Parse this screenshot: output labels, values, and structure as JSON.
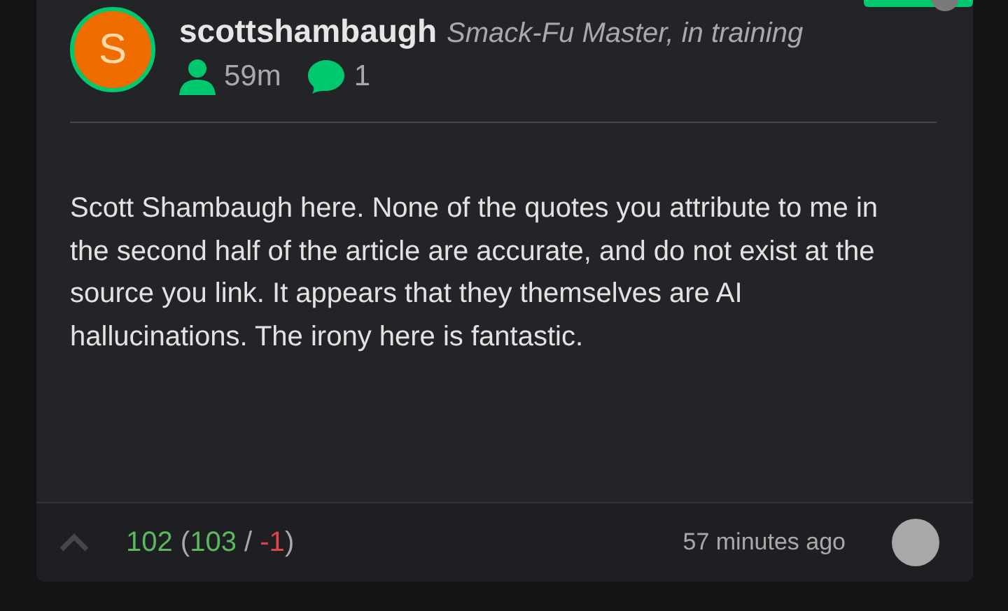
{
  "comment": {
    "avatar_letter": "S",
    "username": "scottshambaugh",
    "user_title": "Smack-Fu Master, in training",
    "member_age": "59m",
    "comment_count": "1",
    "body": "Scott Shambaugh here. None of the quotes you attribute to me in the second half of the article are accurate, and do not exist at the source you link. It appears that they themselves are AI hallucinations. The irony here is fantastic.",
    "votes": [
      {
        "text": "102",
        "kind": "positive"
      },
      {
        "text": " (",
        "kind": "neutral"
      },
      {
        "text": "103",
        "kind": "positive"
      },
      {
        "text": " / ",
        "kind": "neutral"
      },
      {
        "text": "-1",
        "kind": "negative"
      },
      {
        "text": ")",
        "kind": "neutral"
      }
    ],
    "timestamp": "57 minutes ago"
  }
}
